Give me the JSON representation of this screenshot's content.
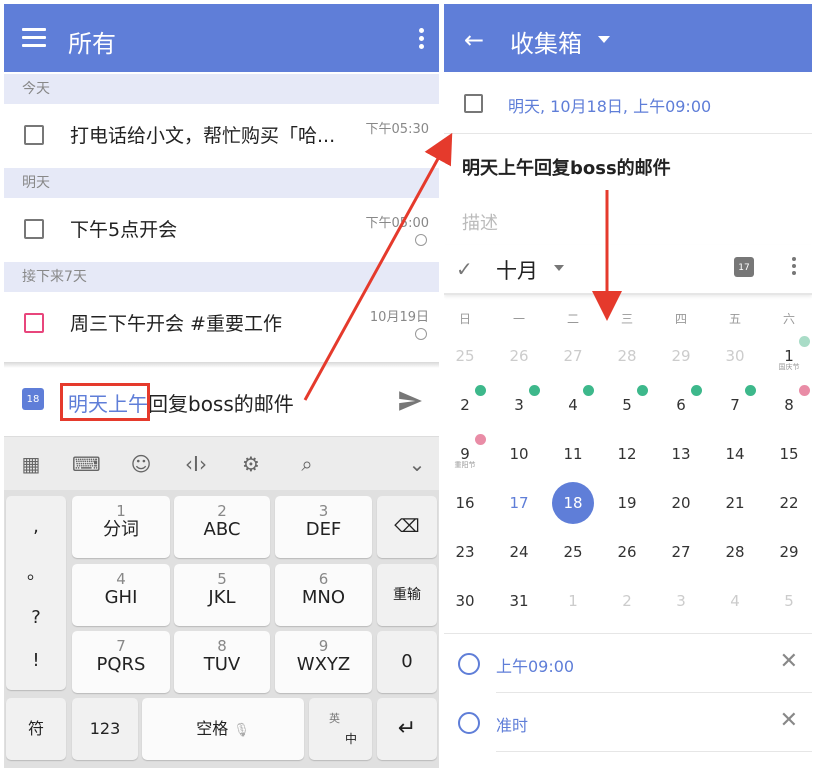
{
  "left_screen": {
    "header": {
      "title": "所有"
    },
    "sections": [
      {
        "label": "今天",
        "tasks": [
          {
            "text": "打电话给小文，帮忙购买「哈...",
            "time": "下午05:30",
            "alarm": false,
            "priority": "none"
          }
        ]
      },
      {
        "label": "明天",
        "tasks": [
          {
            "text": "下午5点开会",
            "time": "下午05:00",
            "alarm": true,
            "priority": "none"
          }
        ]
      },
      {
        "label": "接下来7天",
        "tasks": [
          {
            "text": "周三下午开会 #重要工作",
            "time": "10月19日",
            "alarm": true,
            "priority": "high"
          }
        ]
      }
    ],
    "compose": {
      "calendar_icon_day": "18",
      "highlighted_text": "明天上午",
      "rest_text": "回复boss的邮件"
    },
    "keyboard": {
      "toolbar_icons": [
        "grid-icon",
        "keyboard-icon",
        "emoji-icon",
        "cursor-icon",
        "settings-icon",
        "search-icon",
        "collapse-icon"
      ],
      "left_column": [
        ",",
        "。",
        "?",
        "!"
      ],
      "keys": [
        {
          "num": "1",
          "label": "分词"
        },
        {
          "num": "2",
          "label": "ABC"
        },
        {
          "num": "3",
          "label": "DEF"
        },
        {
          "num": "4",
          "label": "GHI"
        },
        {
          "num": "5",
          "label": "JKL"
        },
        {
          "num": "6",
          "label": "MNO"
        },
        {
          "num": "7",
          "label": "PQRS"
        },
        {
          "num": "8",
          "label": "TUV"
        },
        {
          "num": "9",
          "label": "WXYZ"
        }
      ],
      "right_column": {
        "backspace": "⌫",
        "reenter": "重输",
        "zero": "0"
      },
      "bottom_row": {
        "symbol": "符",
        "num": "123",
        "space": "空格",
        "lang_top": "英",
        "lang_bottom": "中",
        "enter": "↵"
      }
    }
  },
  "right_screen": {
    "header": {
      "title": "收集箱"
    },
    "date_text": "明天, 10月18日, 上午09:00",
    "task_title": "明天上午回复boss的邮件",
    "description_placeholder": "描述",
    "calendar": {
      "month_label": "十月",
      "today_icon_day": "17",
      "weekdays": [
        "日",
        "一",
        "二",
        "三",
        "四",
        "五",
        "六"
      ],
      "weeks": [
        [
          {
            "d": "25",
            "muted": true
          },
          {
            "d": "26",
            "muted": true
          },
          {
            "d": "27",
            "muted": true
          },
          {
            "d": "28",
            "muted": true
          },
          {
            "d": "29",
            "muted": true
          },
          {
            "d": "30",
            "muted": true
          },
          {
            "d": "1",
            "badge": "faint",
            "sub": "国庆节"
          }
        ],
        [
          {
            "d": "2",
            "badge": "green"
          },
          {
            "d": "3",
            "badge": "green"
          },
          {
            "d": "4",
            "badge": "green"
          },
          {
            "d": "5",
            "badge": "green"
          },
          {
            "d": "6",
            "badge": "green"
          },
          {
            "d": "7",
            "badge": "green"
          },
          {
            "d": "8",
            "badge": "pink"
          }
        ],
        [
          {
            "d": "9",
            "badge": "pink",
            "sub": "重阳节"
          },
          {
            "d": "10"
          },
          {
            "d": "11"
          },
          {
            "d": "12"
          },
          {
            "d": "13"
          },
          {
            "d": "14"
          },
          {
            "d": "15"
          }
        ],
        [
          {
            "d": "16"
          },
          {
            "d": "17",
            "today": true
          },
          {
            "d": "18",
            "selected": true
          },
          {
            "d": "19"
          },
          {
            "d": "20"
          },
          {
            "d": "21"
          },
          {
            "d": "22"
          }
        ],
        [
          {
            "d": "23"
          },
          {
            "d": "24"
          },
          {
            "d": "25"
          },
          {
            "d": "26"
          },
          {
            "d": "27"
          },
          {
            "d": "28"
          },
          {
            "d": "29"
          }
        ],
        [
          {
            "d": "30"
          },
          {
            "d": "31"
          },
          {
            "d": "1",
            "muted": true
          },
          {
            "d": "2",
            "muted": true
          },
          {
            "d": "3",
            "muted": true
          },
          {
            "d": "4",
            "muted": true
          },
          {
            "d": "5",
            "muted": true
          }
        ]
      ]
    },
    "time_option": "上午09:00",
    "reminder_option": "准时"
  },
  "colors": {
    "accent": "#5f7ed8",
    "highlight_red": "#e53a2c",
    "priority_high": "#e8467c",
    "holiday_green": "#3db88b"
  }
}
